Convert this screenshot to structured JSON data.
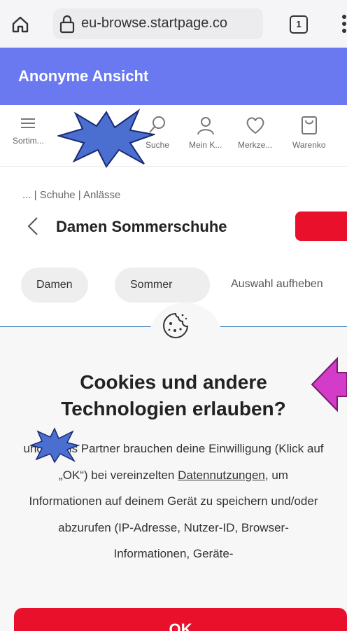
{
  "browser": {
    "url": "eu-browse.startpage.co",
    "tab_count": "1"
  },
  "banner": {
    "title": "Anonyme Ansicht"
  },
  "nav": {
    "items": [
      {
        "label": "Sortim...",
        "icon": "hamburger-icon"
      },
      {
        "label": "Suche",
        "icon": "search-icon"
      },
      {
        "label": "Mein K...",
        "icon": "user-icon"
      },
      {
        "label": "Merkze...",
        "icon": "heart-icon"
      },
      {
        "label": "Warenko",
        "icon": "bag-icon"
      }
    ]
  },
  "breadcrumb": "... | Schuhe | Anlässe",
  "page_title": "Damen Sommerschuhe",
  "filters": {
    "chips": [
      "Damen",
      "Sommer"
    ],
    "clear": "Auswahl aufheben"
  },
  "modal": {
    "title_line1": "Cookies und andere",
    "title_line2": "Technologien erlauben?",
    "body_part1": "und sechs Partner brauchen deine Einwilligung (Klick auf „OK“) bei vereinzelten ",
    "body_link": "Datennutzungen",
    "body_part2": ", um Informationen auf deinem Gerät zu speichern und/oder abzurufen (IP-Adresse, Nutzer-ID, Browser-Informationen, Geräte-",
    "ok_label": "OK"
  },
  "colors": {
    "banner": "#6a79f0",
    "brand_red": "#e8102a",
    "annotation_arrow": "#d33cc8",
    "annotation_star": "#4a6fd0"
  }
}
